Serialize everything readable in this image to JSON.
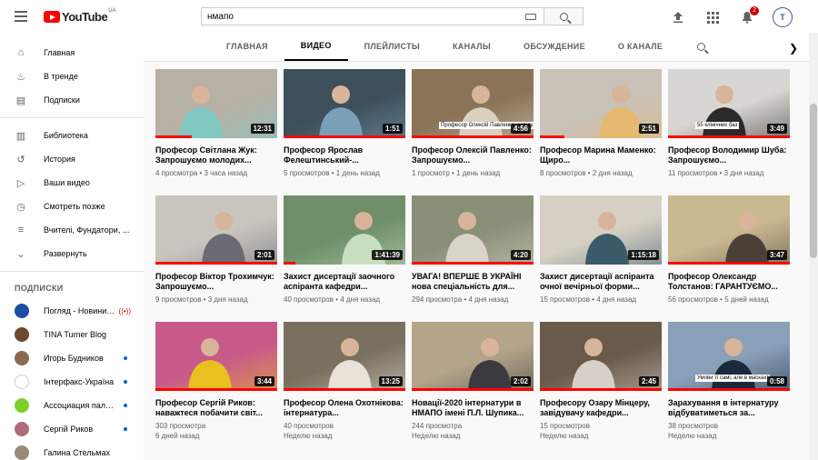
{
  "header": {
    "logo_text": "YouTube",
    "logo_region": "UA",
    "search_value": "нмапо",
    "notification_count": "2",
    "avatar_text": "Т"
  },
  "sidebar": {
    "items": [
      {
        "label": "Главная",
        "icon": "home-icon"
      },
      {
        "label": "В тренде",
        "icon": "fire-icon"
      },
      {
        "label": "Подписки",
        "icon": "subscriptions-icon"
      },
      {
        "label": "Библиотека",
        "icon": "library-icon"
      },
      {
        "label": "История",
        "icon": "history-icon"
      },
      {
        "label": "Ваши видео",
        "icon": "your-videos-icon"
      },
      {
        "label": "Смотреть позже",
        "icon": "watch-later-icon"
      },
      {
        "label": "Вчителі, Фундатори, ...",
        "icon": "playlist-icon"
      },
      {
        "label": "Развернуть",
        "icon": "chevron-down-icon"
      }
    ],
    "subscriptions_heading": "ПОДПИСКИ",
    "subscriptions": [
      {
        "name": "Погляд - Новини ...",
        "status": "live",
        "color": "#1a4fa0"
      },
      {
        "name": "TINA Turner Blog",
        "status": "none",
        "color": "#6b4a2f"
      },
      {
        "name": "Игорь Будников",
        "status": "dot",
        "color": "#8a6b52"
      },
      {
        "name": "Інтерфакс-Україна",
        "status": "dot",
        "color": "#ffffff"
      },
      {
        "name": "Ассоциация паллиа...",
        "status": "dot",
        "color": "#7fcf2a"
      },
      {
        "name": "Сергій Риков",
        "status": "dot",
        "color": "#b06a7a"
      },
      {
        "name": "Галина Стельмах",
        "status": "none",
        "color": "#9a8a7a"
      }
    ]
  },
  "tabs": [
    "ГЛАВНАЯ",
    "ВИДЕО",
    "ПЛЕЙЛИСТЫ",
    "КАНАЛЫ",
    "ОБСУЖДЕНИЕ",
    "О КАНАЛЕ"
  ],
  "active_tab": "ВИДЕО",
  "videos": [
    {
      "title": "Професор Світлана Жук: Запрошуємо молодих...",
      "views": "4 просмотра",
      "age": "3 часа назад",
      "duration": "12:31",
      "progress": 0.3,
      "bg": "#b7b0a4",
      "accent": "#7fc7c0"
    },
    {
      "title": "Професор Ярослав Фелештинський-...",
      "views": "5 просмотров",
      "age": "1 день назад",
      "duration": "1:51",
      "progress": 1.0,
      "bg": "#3c4f5a",
      "accent": "#7aa0b8"
    },
    {
      "title": "Професор Олексій Павленко: Запрошуємо...",
      "views": "1 просмотр",
      "age": "1 день назад",
      "duration": "4:56",
      "progress": 1.0,
      "bg": "#8a7356",
      "accent": "#d9d0c0",
      "overlay": "Професор Олексій Павленко, завідувач кафедри"
    },
    {
      "title": "Професор Марина Маменко: Щиро...",
      "views": "8 просмотров",
      "age": "2 дня назад",
      "duration": "2:51",
      "progress": 0.2,
      "bg": "#c8c2b8",
      "accent": "#e6b870"
    },
    {
      "title": "Професор Володимир Шуба: Запрошуємо...",
      "views": "11 просмотров",
      "age": "3 дня назад",
      "duration": "3:49",
      "progress": 1.0,
      "bg": "#d8d6d2",
      "accent": "#2a2a2a",
      "overlay": "55 клінічних баз"
    },
    {
      "title": "Професор Віктор Трохимчук: Запрошуємо...",
      "views": "9 просмотров",
      "age": "3 дня назад",
      "duration": "2:01",
      "progress": 1.0,
      "bg": "#c9c6c0",
      "accent": "#6a6a72"
    },
    {
      "title": "Захист дисертації заочного аспіранта кафедри...",
      "views": "40 просмотров",
      "age": "4 дня назад",
      "duration": "1:41:39",
      "progress": 0.1,
      "bg": "#6f8f6a",
      "accent": "#c8e0c0"
    },
    {
      "title": "УВАГА! ВПЕРШЕ В УКРАЇНІ нова спеціальність для...",
      "views": "294 просмотра",
      "age": "4 дня назад",
      "duration": "4:20",
      "progress": 1.0,
      "bg": "#8a8f78",
      "accent": "#d9d4c8"
    },
    {
      "title": "Захист дисертації аспіранта очної вечірньої форми...",
      "views": "15 просмотров",
      "age": "4 дня назад",
      "duration": "1:15:18",
      "progress": 0.0,
      "bg": "#d6d0c4",
      "accent": "#3a5a6a"
    },
    {
      "title": "Професор Олександр Толстанов: ГАРАНТУЄМО...",
      "views": "56 просмотров",
      "age": "5 дней назад",
      "duration": "3:47",
      "progress": 1.0,
      "bg": "#c9b890",
      "accent": "#4a4038"
    },
    {
      "title": "Професор Сергій Риков: наважтеся побачити світ...",
      "views": "303 просмотра",
      "age": "6 дней назад",
      "duration": "3:44",
      "progress": 1.0,
      "bg": "#c85a8a",
      "accent": "#e8c020"
    },
    {
      "title": "Професор Олена Охотнікова: інтернатура...",
      "views": "40 просмотров",
      "age": "Неделю назад",
      "duration": "13:25",
      "progress": 1.0,
      "bg": "#7a7060",
      "accent": "#e8e2d8"
    },
    {
      "title": "Новації-2020 інтернатури в НМАПО імені П.Л. Шупика...",
      "views": "244 просмотра",
      "age": "Неделю назад",
      "duration": "2:02",
      "progress": 1.0,
      "bg": "#b4a48a",
      "accent": "#3a3a40"
    },
    {
      "title": "Професору Озару Мінцеру, завідувачу кафедри...",
      "views": "15 просмотров",
      "age": "Неделю назад",
      "duration": "2:45",
      "progress": 1.0,
      "bg": "#6a5a4a",
      "accent": "#d8d0c8"
    },
    {
      "title": "Зарахування в інтернатуру відбуватиметься за...",
      "views": "38 просмотров",
      "age": "Неделю назад",
      "duration": "0:58",
      "progress": 1.0,
      "bg": "#8aa0b8",
      "accent": "#1a2a3a",
      "overlay": "Умови ті самі, але в масках!"
    }
  ]
}
